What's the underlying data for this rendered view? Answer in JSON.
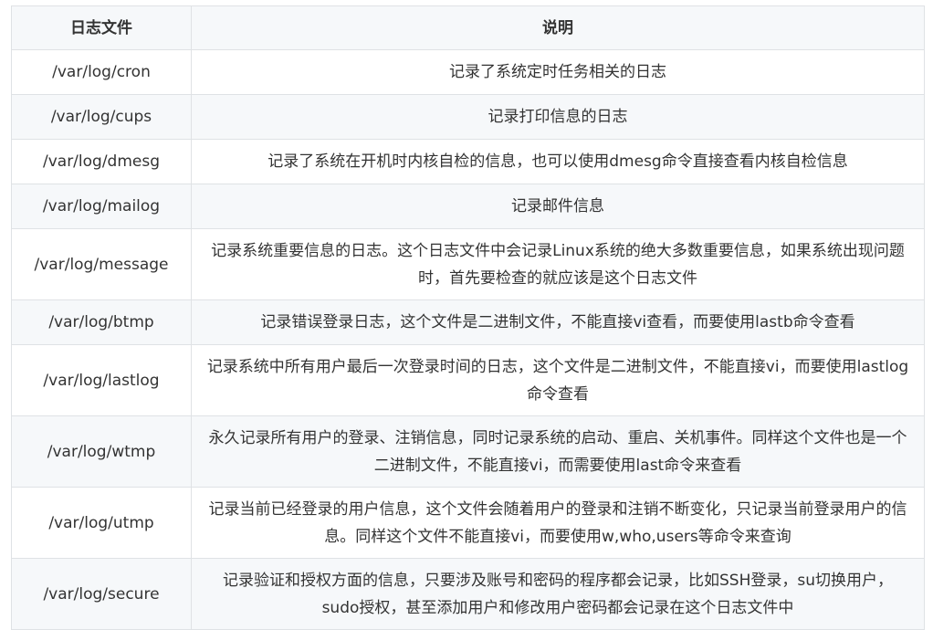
{
  "table": {
    "headers": [
      "日志文件",
      "说明"
    ],
    "rows": [
      {
        "file": "/var/log/cron",
        "desc": "记录了系统定时任务相关的日志"
      },
      {
        "file": "/var/log/cups",
        "desc": "记录打印信息的日志"
      },
      {
        "file": "/var/log/dmesg",
        "desc": "记录了系统在开机时内核自检的信息，也可以使用dmesg命令直接查看内核自检信息"
      },
      {
        "file": "/var/log/mailog",
        "desc": "记录邮件信息"
      },
      {
        "file": "/var/log/message",
        "desc": "记录系统重要信息的日志。这个日志文件中会记录Linux系统的绝大多数重要信息，如果系统出现问题时，首先要检查的就应该是这个日志文件"
      },
      {
        "file": "/var/log/btmp",
        "desc": "记录错误登录日志，这个文件是二进制文件，不能直接vi查看，而要使用lastb命令查看"
      },
      {
        "file": "/var/log/lastlog",
        "desc": "记录系统中所有用户最后一次登录时间的日志，这个文件是二进制文件，不能直接vi，而要使用lastlog命令查看"
      },
      {
        "file": "/var/log/wtmp",
        "desc": "永久记录所有用户的登录、注销信息，同时记录系统的启动、重启、关机事件。同样这个文件也是一个二进制文件，不能直接vi，而需要使用last命令来查看"
      },
      {
        "file": "/var/log/utmp",
        "desc": "记录当前已经登录的用户信息，这个文件会随着用户的登录和注销不断变化，只记录当前登录用户的信息。同样这个文件不能直接vi，而要使用w,who,users等命令来查询"
      },
      {
        "file": "/var/log/secure",
        "desc": "记录验证和授权方面的信息，只要涉及账号和密码的程序都会记录，比如SSH登录，su切换用户，sudo授权，甚至添加用户和修改用户密码都会记录在这个日志文件中"
      }
    ]
  }
}
